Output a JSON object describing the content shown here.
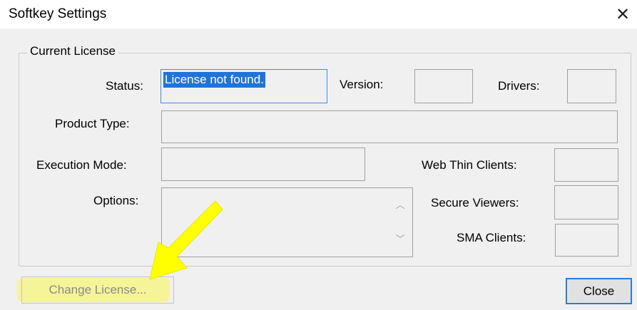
{
  "window": {
    "title": "Softkey Settings"
  },
  "group": {
    "legend": "Current License"
  },
  "labels": {
    "status": "Status:",
    "version": "Version:",
    "drivers": "Drivers:",
    "product_type": "Product Type:",
    "execution_mode": "Execution Mode:",
    "web_thin_clients": "Web Thin Clients:",
    "options": "Options:",
    "secure_viewers": "Secure Viewers:",
    "sma_clients": "SMA Clients:"
  },
  "values": {
    "status": "License not found.",
    "version": "",
    "drivers": "",
    "product_type": "",
    "execution_mode": "",
    "web_thin_clients": "",
    "options": "",
    "secure_viewers": "",
    "sma_clients": ""
  },
  "buttons": {
    "change_license": "Change License...",
    "close": "Close"
  },
  "icons": {
    "window_close": "close-icon",
    "scroll_up": "scroll-up-icon",
    "scroll_down": "scroll-down-icon",
    "annotation": "yellow-arrow-annotation"
  },
  "colors": {
    "selection": "#1e74d8",
    "highlight": "#f7f58a",
    "arrow": "#ffff00"
  }
}
